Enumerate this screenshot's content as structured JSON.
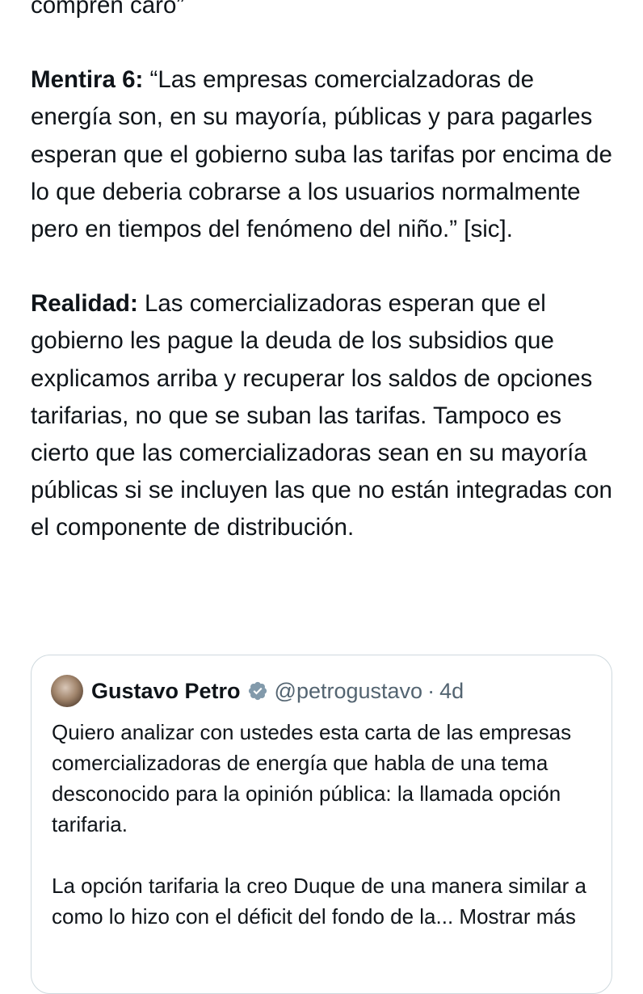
{
  "tweet": {
    "top_fragment": "compren caro”",
    "lie_label": "Mentira 6:",
    "lie_text": " “Las empresas comercialzadoras de energía son, en su mayoría, públicas y para pagarles esperan que el gobierno suba las tarifas por encima de lo que deberia cobrarse a los usuarios normalmente pero en tiempos del fenómeno del niño.” [sic].",
    "reality_label": "Realidad:",
    "reality_text": " Las comercializadoras esperan que el gobierno les pague la deuda de los subsidios que explicamos arriba y recuperar los saldos de opciones tarifarias, no que se suban las tarifas. Tampoco es cierto que las comercializadoras sean en su mayoría públicas si se incluyen las que no están integradas con el componente de distribución."
  },
  "quote": {
    "author_name": "Gustavo Petro",
    "handle": "@petrogustavo",
    "separator": "·",
    "time": "4d",
    "verified_color": "#829aab",
    "avatar_icon": "avatar-photo",
    "verified_icon": "verified-badge-icon",
    "paragraph_1": "Quiero analizar con ustedes esta carta de las empresas comercializadoras de energía que habla de una tema desconocido para la opinión pública: la llamada opción tarifaria.",
    "paragraph_2": "La opción tarifaria la creo Duque de una manera similar a como lo hizo con el déficit del fondo de la...",
    "show_more": "Mostrar más"
  }
}
